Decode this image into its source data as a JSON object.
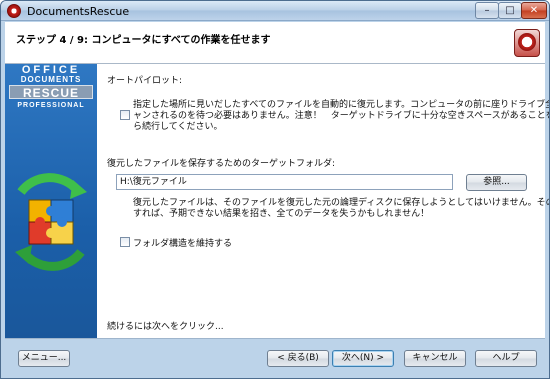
{
  "window": {
    "title": "DocumentsRescue",
    "controls": {
      "minimize": "–",
      "maximize": "□",
      "close": "✕"
    }
  },
  "header": {
    "title": "ステップ 4 / 9: コンピュータにすべての作業を任せます"
  },
  "sidebar": {
    "brand_line1": "OFFICE",
    "brand_line2": "DOCUMENTS",
    "brand_line3": "RESCUE",
    "brand_line4": "PROFESSIONAL"
  },
  "main": {
    "autopilot_label": "オートパイロット:",
    "autopilot_desc_line1": "指定した場所に見いだしたすべてのファイルを自動的に復元します。コンピュータの前に座りドライブ全体がスキ",
    "autopilot_desc_line2": "ャンされるのを待つ必要はありません。注意！　ターゲットドライブに十分な空きスペースがあることを確認してか",
    "autopilot_desc_line3": "ら続行してください。",
    "target_label": "復元したファイルを保存するためのターゲットフォルダ:",
    "target_path": "H:\\復元ファイル",
    "browse_button": "参照...",
    "warning_line1": "復元したファイルは、そのファイルを復元した元の論理ディスクに保存しようとしてはいけません。そのようなことを",
    "warning_line2": "すれば、予期できない結果を招き、全てのデータを失うかもしれません！",
    "keep_structure_label": "フォルダ構造を維持する",
    "continue_hint": "続けるには次へをクリック..."
  },
  "footer": {
    "menu_button": "メニュー...",
    "back_button": "< 戻る(B)",
    "next_button": "次へ(N) >",
    "cancel_button": "キャンセル",
    "help_button": "ヘルプ"
  },
  "colors": {
    "sidebar_blue": "#1b5fa9",
    "accent_red": "#c0231d",
    "window_frame": "#bcd3e9"
  },
  "icons": {
    "app": "red-ring-logo-icon",
    "header_logo": "lifebuoy-logo-icon",
    "sidebar_art": "puzzle-recycle-icon"
  }
}
